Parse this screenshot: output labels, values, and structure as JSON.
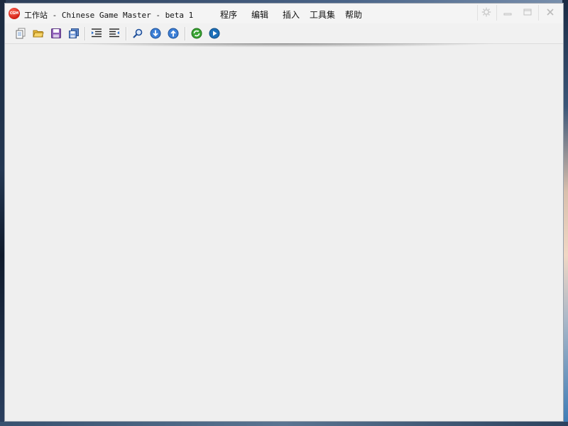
{
  "window": {
    "title": "工作站 - Chinese Game Master - beta 1",
    "logo_text": "CGM"
  },
  "menu": [
    {
      "label": "程序"
    },
    {
      "label": "编辑"
    },
    {
      "label": "插入"
    },
    {
      "label": "工具集"
    },
    {
      "label": "帮助"
    }
  ],
  "window_controls": [
    "gear-icon",
    "minimize-icon",
    "maximize-icon",
    "close-icon"
  ],
  "toolbar": {
    "buttons": [
      "new-document-icon",
      "open-folder-icon",
      "save-icon",
      "save-all-icon",
      "indent-icon",
      "outdent-icon",
      "search-icon",
      "arrow-down-icon",
      "arrow-up-icon",
      "refresh-icon",
      "play-icon"
    ]
  },
  "colors": {
    "logo_red": "#d11d12",
    "content_bg": "#efefef",
    "accent_blue": "#2a6bc4",
    "accent_green": "#3aa334"
  }
}
